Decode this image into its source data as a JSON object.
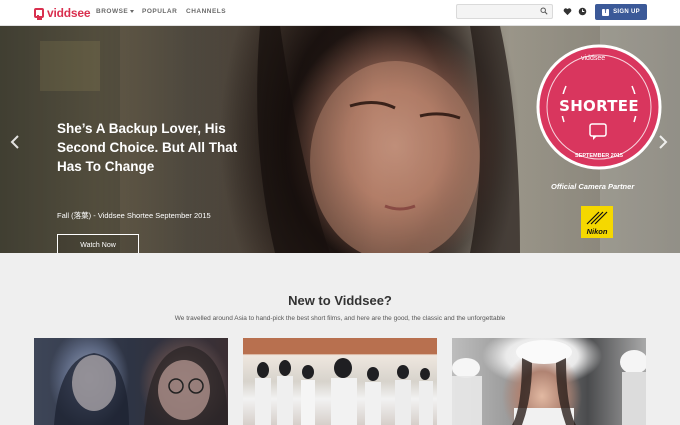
{
  "nav": {
    "logo": "viddsee",
    "browse": "BROWSE",
    "popular": "POPULAR",
    "channels": "CHANNELS",
    "search_placeholder": "",
    "signup": "SIGN UP",
    "fb_glyph": "f"
  },
  "hero": {
    "title": "She’s A Backup Lover, His Second Choice. But All That Has To Change",
    "subtitle": "Fall (落葉) - Viddsee Shortee September 2015",
    "watch_label": "Watch Now",
    "slide_count": 11,
    "active_slide": 1,
    "badge": {
      "brand": "viddsee",
      "name": "SHORTEE",
      "date": "SEPTEMBER 2015",
      "color": "#d9365e"
    },
    "partner_label": "Official Camera Partner",
    "partner_logo": "Nikon"
  },
  "section": {
    "title": "New to Viddsee?",
    "description": "We travelled around Asia to hand-pick the best short films, and here are the good, the classic and the unforgettable"
  },
  "colors": {
    "brand": "#d9304f",
    "facebook": "#3b5998"
  }
}
